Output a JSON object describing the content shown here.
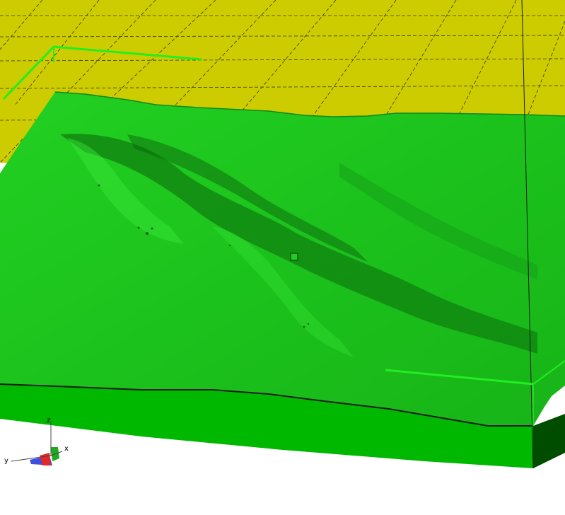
{
  "viewer": {
    "axis_labels": {
      "x": "x",
      "y": "y",
      "z": "z"
    }
  },
  "colors": {
    "background": "#ffffff",
    "ground_plane": "#cccc00",
    "grid_line": "#3a3a00",
    "terrain_top": "#1fcf1f",
    "terrain_side": "#00b800",
    "terrain_side_dark": "#004d00",
    "bounding_line": "#1a1a1a",
    "highlight": "#22ee22",
    "axis_x": "#1faa1f",
    "axis_y": "#3b50e0",
    "axis_z": "#e02a2a"
  }
}
